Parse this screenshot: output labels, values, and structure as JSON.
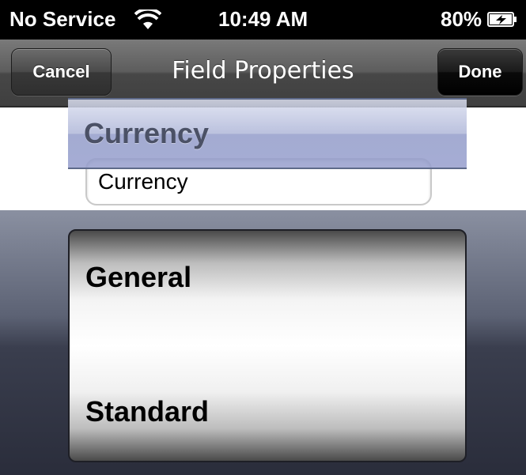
{
  "status_bar": {
    "carrier": "No Service",
    "time": "10:49 AM",
    "battery_percent": "80%",
    "battery_level": 0.8,
    "icons": [
      "wifi-icon",
      "battery-charging-icon"
    ]
  },
  "nav_bar": {
    "title": "Field Properties",
    "cancel_label": "Cancel",
    "done_label": "Done"
  },
  "text_field": {
    "value": "Currency"
  },
  "picker": {
    "options": [
      "General",
      "Currency",
      "Standard"
    ],
    "selected": "Currency"
  }
}
